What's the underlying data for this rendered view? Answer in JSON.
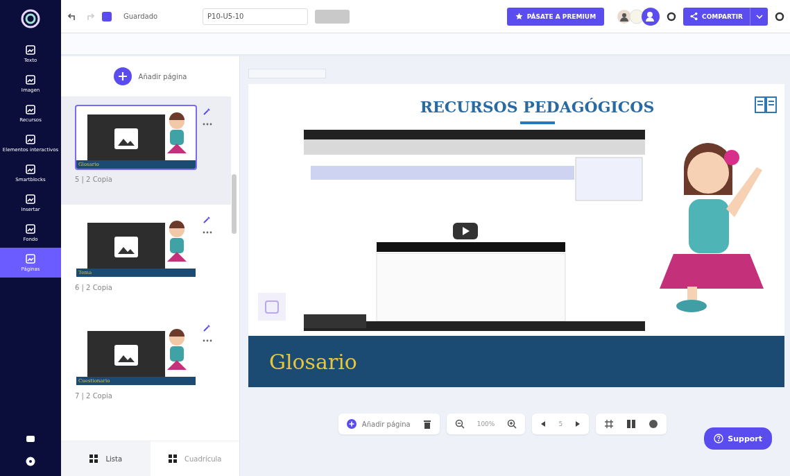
{
  "rail": {
    "items": [
      {
        "label": "Texto",
        "selected": false
      },
      {
        "label": "Imagen",
        "selected": false
      },
      {
        "label": "Recursos",
        "selected": false
      },
      {
        "label": "Elementos interactivos",
        "selected": false
      },
      {
        "label": "Smartblocks",
        "selected": false
      },
      {
        "label": "Insertar",
        "selected": false
      },
      {
        "label": "Fondo",
        "selected": false
      },
      {
        "label": "Páginas",
        "selected": true
      }
    ]
  },
  "toolbar": {
    "status": "Guardado",
    "title_field": "P10-U5-10",
    "premium_button": "PÁSATE A PREMIUM",
    "share_button": "COMPARTIR"
  },
  "pages_panel": {
    "add_button": "Añadir página",
    "pages": [
      {
        "label": "5 | 2 Copia",
        "thumb_title": "Glosario",
        "selected": true
      },
      {
        "label": "6 | 2 Copia",
        "thumb_title": "Tema",
        "selected": false
      },
      {
        "label": "7 | 2 Copia",
        "thumb_title": "Cuestionario",
        "selected": false
      }
    ],
    "view_tabs": [
      {
        "label": "Lista",
        "selected": true
      },
      {
        "label": "Cuadrícula",
        "selected": false
      }
    ]
  },
  "slide": {
    "title": "RECURSOS PEDAGÓGICOS",
    "banner": "Glosario"
  },
  "bottom_bar": {
    "add_button": "Añadir página",
    "zoom": "100%",
    "page": "5"
  },
  "support_button": "Support"
}
